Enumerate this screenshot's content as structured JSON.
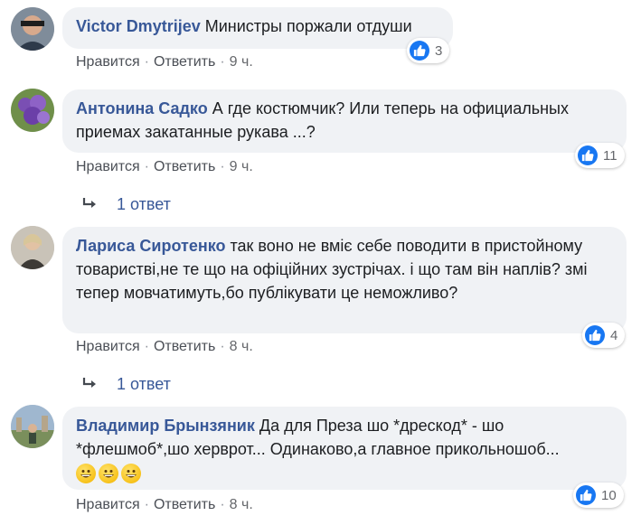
{
  "comments": [
    {
      "author": "Victor Dmytrijev",
      "text": "Министры поржали отдуши",
      "reactions": "3",
      "like_label": "Нравится",
      "reply_label": "Ответить",
      "time": "9 ч."
    },
    {
      "author": "Антонина Садко",
      "text": "А где костюмчик? Или теперь на официальных приемах закатанные рукава ...?",
      "reactions": "11",
      "like_label": "Нравится",
      "reply_label": "Ответить",
      "time": "9 ч.",
      "replies": "1 ответ"
    },
    {
      "author": "Лариса Сиротенко",
      "text": "так воно не вміє себе поводити в пристойному товаристві,не те що на офіційних зустрічах. і що там він наплів? змі тепер мовчатимуть,бо публікувати це неможливо?",
      "reactions": "4",
      "like_label": "Нравится",
      "reply_label": "Ответить",
      "time": "8 ч.",
      "replies": "1 ответ"
    },
    {
      "author": "Владимир Брынзяник",
      "text": "Да для Преза шо *дрескод* - шо *флешмоб*,шо херврот... Одинаково,а главное прикольношоб...",
      "emoji": "😀😀😀",
      "reactions": "10",
      "like_label": "Нравится",
      "reply_label": "Ответить",
      "time": "8 ч."
    }
  ],
  "colors": {
    "author": "#385898",
    "bubble": "#f0f2f5",
    "like_badge": "#1877f2",
    "meta": "#65676b"
  },
  "icons": {
    "reaction": "thumbs-up-icon",
    "replies": "reply-arrow-icon",
    "emoji": "grinning-face-icon"
  }
}
